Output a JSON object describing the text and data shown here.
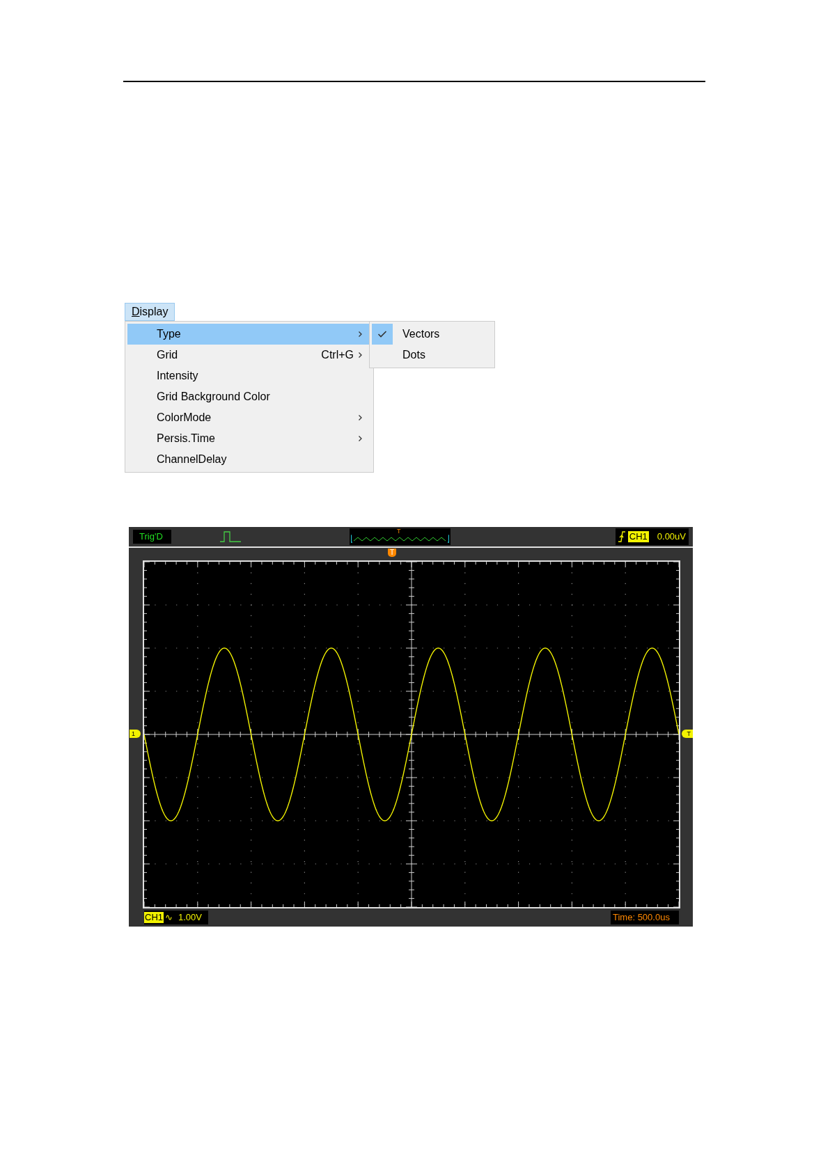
{
  "menu": {
    "title": "Display",
    "items": [
      {
        "label": "Type",
        "submenu": true,
        "selected": true
      },
      {
        "label": "Grid",
        "shortcut": "Ctrl+G",
        "submenu": true,
        "selected": false
      },
      {
        "label": "Intensity",
        "submenu": false,
        "selected": false
      },
      {
        "label": "Grid Background Color",
        "submenu": false,
        "selected": false
      },
      {
        "label": "ColorMode",
        "submenu": true,
        "selected": false
      },
      {
        "label": "Persis.Time",
        "submenu": true,
        "selected": false
      },
      {
        "label": "ChannelDelay",
        "submenu": false,
        "selected": false
      }
    ],
    "submenu": [
      {
        "label": "Vectors",
        "checked": true
      },
      {
        "label": "Dots",
        "checked": false
      }
    ]
  },
  "scope": {
    "trigger_status": "Trig'D",
    "overview_marker": "T",
    "trigger_channel": "CH1",
    "trigger_level": "0.00uV",
    "trigger_position_marker": "T",
    "channel_marker": "1",
    "trigger_level_marker": "T",
    "channel": "CH1",
    "coupling_symbol": "∿",
    "volts_per_div": "1.00V",
    "timebase": "Time: 500.0us"
  }
}
